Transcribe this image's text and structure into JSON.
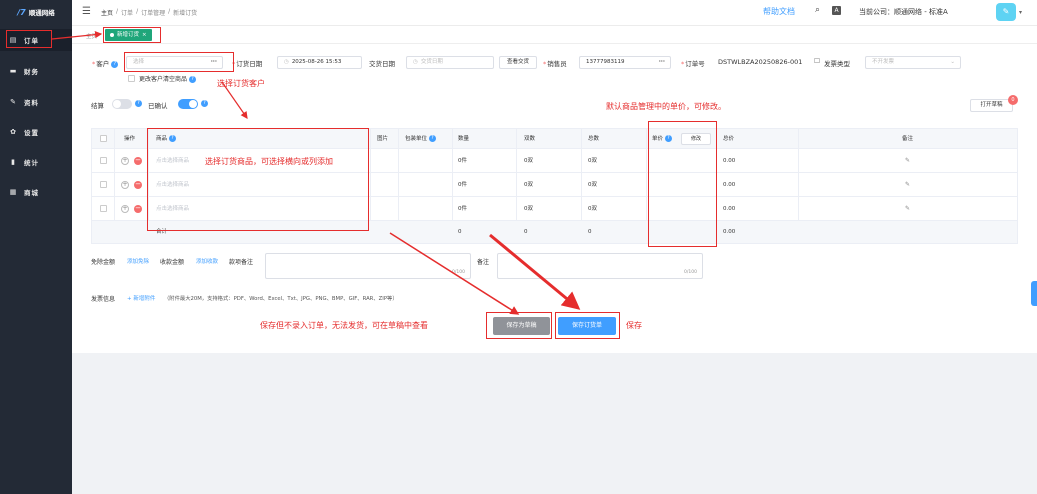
{
  "sidebar": {
    "logo": "顺通网络",
    "items": [
      {
        "label": "订单",
        "icon": "order-icon"
      },
      {
        "label": "财务",
        "icon": "wallet-icon"
      },
      {
        "label": "资料",
        "icon": "edit-icon"
      },
      {
        "label": "设置",
        "icon": "gear-icon"
      },
      {
        "label": "统计",
        "icon": "bar-chart-icon"
      },
      {
        "label": "商城",
        "icon": "shop-icon"
      }
    ]
  },
  "topbar": {
    "breadcrumb": [
      "主页",
      "订单",
      "订单管理",
      "新增订货"
    ],
    "help": "帮助文档",
    "company": "当前公司：顺通网络 - 标准A"
  },
  "tabs": {
    "home": "主页",
    "active": "新增订货"
  },
  "form": {
    "customer_label": "客户",
    "customer_placeholder": "选择",
    "order_date_label": "订货日期",
    "order_date_value": "2025-08-26 15:53",
    "delivery_date_label": "交货日期",
    "delivery_date_placeholder": "交货日期",
    "check_delivery_btn": "查看交货",
    "salesman_label": "销售员",
    "salesman_value": "13777983119",
    "order_no_label": "订单号",
    "order_no_value": "DSTWLBZA20250826-001",
    "invoice_type_label": "发票类型",
    "invoice_type_placeholder": "不开发票",
    "clear_goods_label": "更改客户清空商品",
    "settle_label": "结算",
    "confirmed_label": "已确认",
    "open_draft_btn": "打开草稿",
    "draft_count": "0"
  },
  "table": {
    "headers": {
      "op": "操作",
      "goods": "商品",
      "image": "图片",
      "pack_unit": "包装单位",
      "qty": "数量",
      "pairs": "双数",
      "total": "总数",
      "price": "单价",
      "modify_btn": "修改",
      "amount": "总价",
      "remark": "备注"
    },
    "rows": [
      {
        "goods": "点击选择商品",
        "qty": "0件",
        "pairs": "0双",
        "total": "0双",
        "amount": "0.00"
      },
      {
        "goods": "点击选择商品",
        "qty": "0件",
        "pairs": "0双",
        "total": "0双",
        "amount": "0.00"
      },
      {
        "goods": "点击选择商品",
        "qty": "0件",
        "pairs": "0双",
        "total": "0双",
        "amount": "0.00"
      }
    ],
    "summary": {
      "label": "合计",
      "qty": "0",
      "pairs": "0",
      "total": "0",
      "amount": "0.00"
    }
  },
  "bottom": {
    "discount_label": "免除金额",
    "add_discount": "添加免除",
    "collect_label": "收款金额",
    "add_collect": "添加收款",
    "payment_note_label": "款项备注",
    "note_label": "备注",
    "counter": "0/100",
    "invoice_info_label": "发票信息",
    "add_attachment": "新增附件",
    "attachment_hint": "（附件最大20M，支持格式：PDF、Word、Excel、Txt、JPG、PNG、BMP、GIF、RAR、ZIP等）",
    "save_draft_btn": "保存为草稿",
    "save_order_btn": "保存订货单"
  },
  "annotations": {
    "select_customer": "选择订货客户",
    "select_goods": "选择订货商品，可选择横向或列添加",
    "default_price": "默认商品管理中的单价，可修改。",
    "draft_note": "保存但不录入订单，无法发货，可在草稿中查看",
    "save_note": "保存"
  },
  "colors": {
    "sidebar": "#232a36",
    "primary": "#409eff",
    "tab_active": "#1fa67a",
    "annotation": "#e52d2d",
    "danger": "#f56c6c"
  }
}
